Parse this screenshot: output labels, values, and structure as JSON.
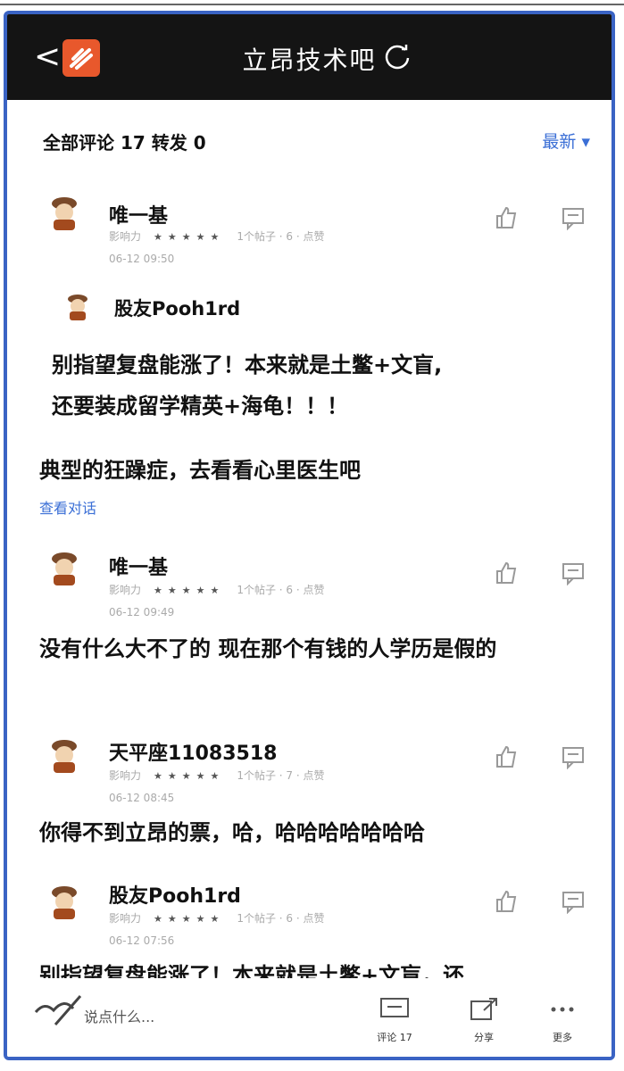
{
  "header": {
    "back_glyph": "<",
    "title": "立昂技术吧",
    "logo_icon": "app-logo-icon",
    "refresh_icon": "refresh-icon"
  },
  "tabs": {
    "all_comments": "全部评论 17 转发 0",
    "sort": "最新 ▾"
  },
  "comments": [
    {
      "user": "唯一基",
      "level": "影响力",
      "stars": "★★★★★",
      "extra": "1个帖子 · 6 · 点赞",
      "time": "06-12 09:50",
      "quoted": {
        "user": "股友Pooh1rd",
        "text_line1": "别指望复盘能涨了！本来就是土鳖+文盲,",
        "text_line2": "还要装成留学精英+海龟！！！"
      },
      "text": "典型的狂躁症，去看看心里医生吧",
      "view_conversation": "查看对话"
    },
    {
      "user": "唯一基",
      "level": "影响力",
      "stars": "★★★★★",
      "extra": "1个帖子 · 6 · 点赞",
      "time": "06-12 09:49",
      "text": "没有什么大不了的 现在那个有钱的人学历是假的"
    },
    {
      "user": "天平座11083518",
      "level": "影响力",
      "stars": "★★★★★",
      "extra": "1个帖子 · 7 · 点赞",
      "time": "06-12 08:45",
      "text": "你得不到立昂的票，哈，哈哈哈哈哈哈哈"
    },
    {
      "user": "股友Pooh1rd",
      "level": "影响力",
      "stars": "★★★★★",
      "extra": "1个帖子 · 6 · 点赞",
      "time": "06-12 07:56",
      "text": "别指望复盘能涨了！本来就是土鳖+文盲，还"
    }
  ],
  "bottom": {
    "placeholder": "说点什么...",
    "comment_label": "评论 17",
    "share_label": "分享",
    "more_label": "更多"
  },
  "colors": {
    "header_bg": "#141414",
    "accent_blue": "#3b6fd6",
    "logo_orange": "#e8582c",
    "frame_blue": "#3a63c4"
  }
}
